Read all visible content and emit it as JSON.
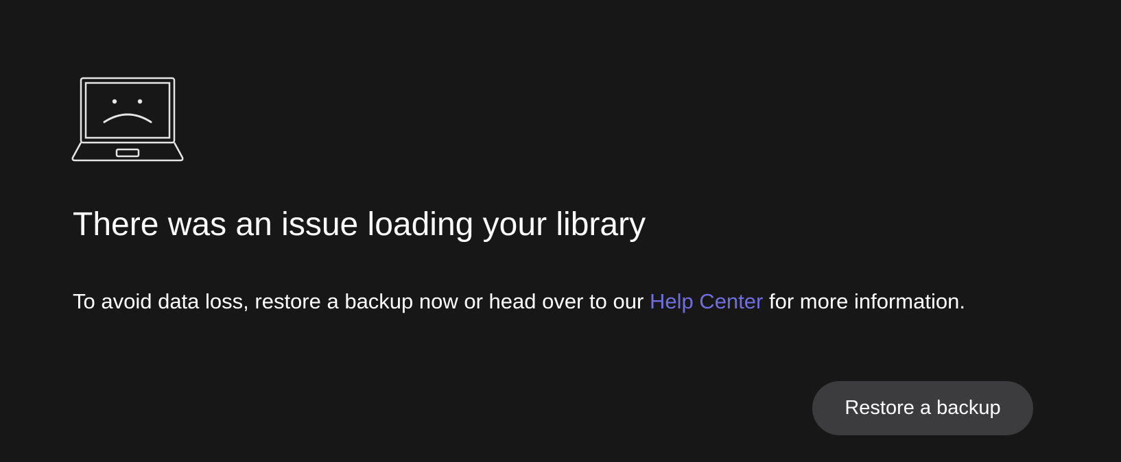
{
  "illustration": {
    "icon": "sad-laptop-icon",
    "stroke_color": "#e6e6e6"
  },
  "error": {
    "title": "There was an issue loading your library",
    "message_before_link": "To avoid data loss, restore a backup now or head over to our ",
    "link_text": "Help Center",
    "message_after_link": " for more information."
  },
  "actions": {
    "restore_label": "Restore a backup"
  },
  "colors": {
    "background": "#171717",
    "text": "#ffffff",
    "link": "#6f6fe0",
    "button_background": "#3c3c3e"
  }
}
